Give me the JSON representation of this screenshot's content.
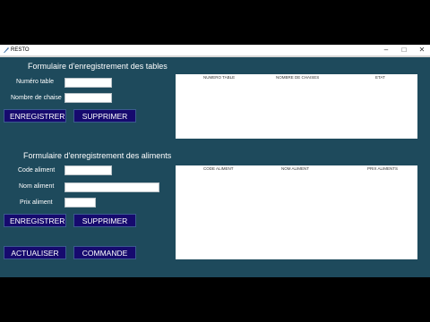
{
  "window": {
    "title": "RESTO",
    "minimize_glyph": "–",
    "maximize_glyph": "□",
    "close_glyph": "✕"
  },
  "tables_form": {
    "heading": "Formulaire d'enregistrement des tables",
    "numero_label": "Numéro table",
    "numero_value": "",
    "chaises_label": "Nombre de chaise",
    "chaises_value": "",
    "save_label": "ENREGISTRER",
    "delete_label": "SUPPRIMER"
  },
  "tables_grid": {
    "columns": [
      "NUMERO TABLE",
      "NOMBRE DE CHAISES",
      "ETAT"
    ],
    "rows": []
  },
  "aliments_form": {
    "heading": "Formulaire d'enregistrement des aliments",
    "code_label": "Code aliment",
    "code_value": "",
    "nom_label": "Nom aliment",
    "nom_value": "",
    "prix_label": "Prix aliment",
    "prix_value": "",
    "save_label": "ENREGISTRER",
    "delete_label": "SUPPRIMER"
  },
  "aliments_grid": {
    "columns": [
      "CODE ALIMENT",
      "NOM ALIMENT",
      "PRIX ALIMENTS"
    ],
    "rows": []
  },
  "footer": {
    "refresh_label": "ACTUALISER",
    "order_label": "COMMANDE"
  },
  "colors": {
    "background": "#1e4a5c",
    "button": "#160a6e",
    "letterbox": "#000000"
  }
}
